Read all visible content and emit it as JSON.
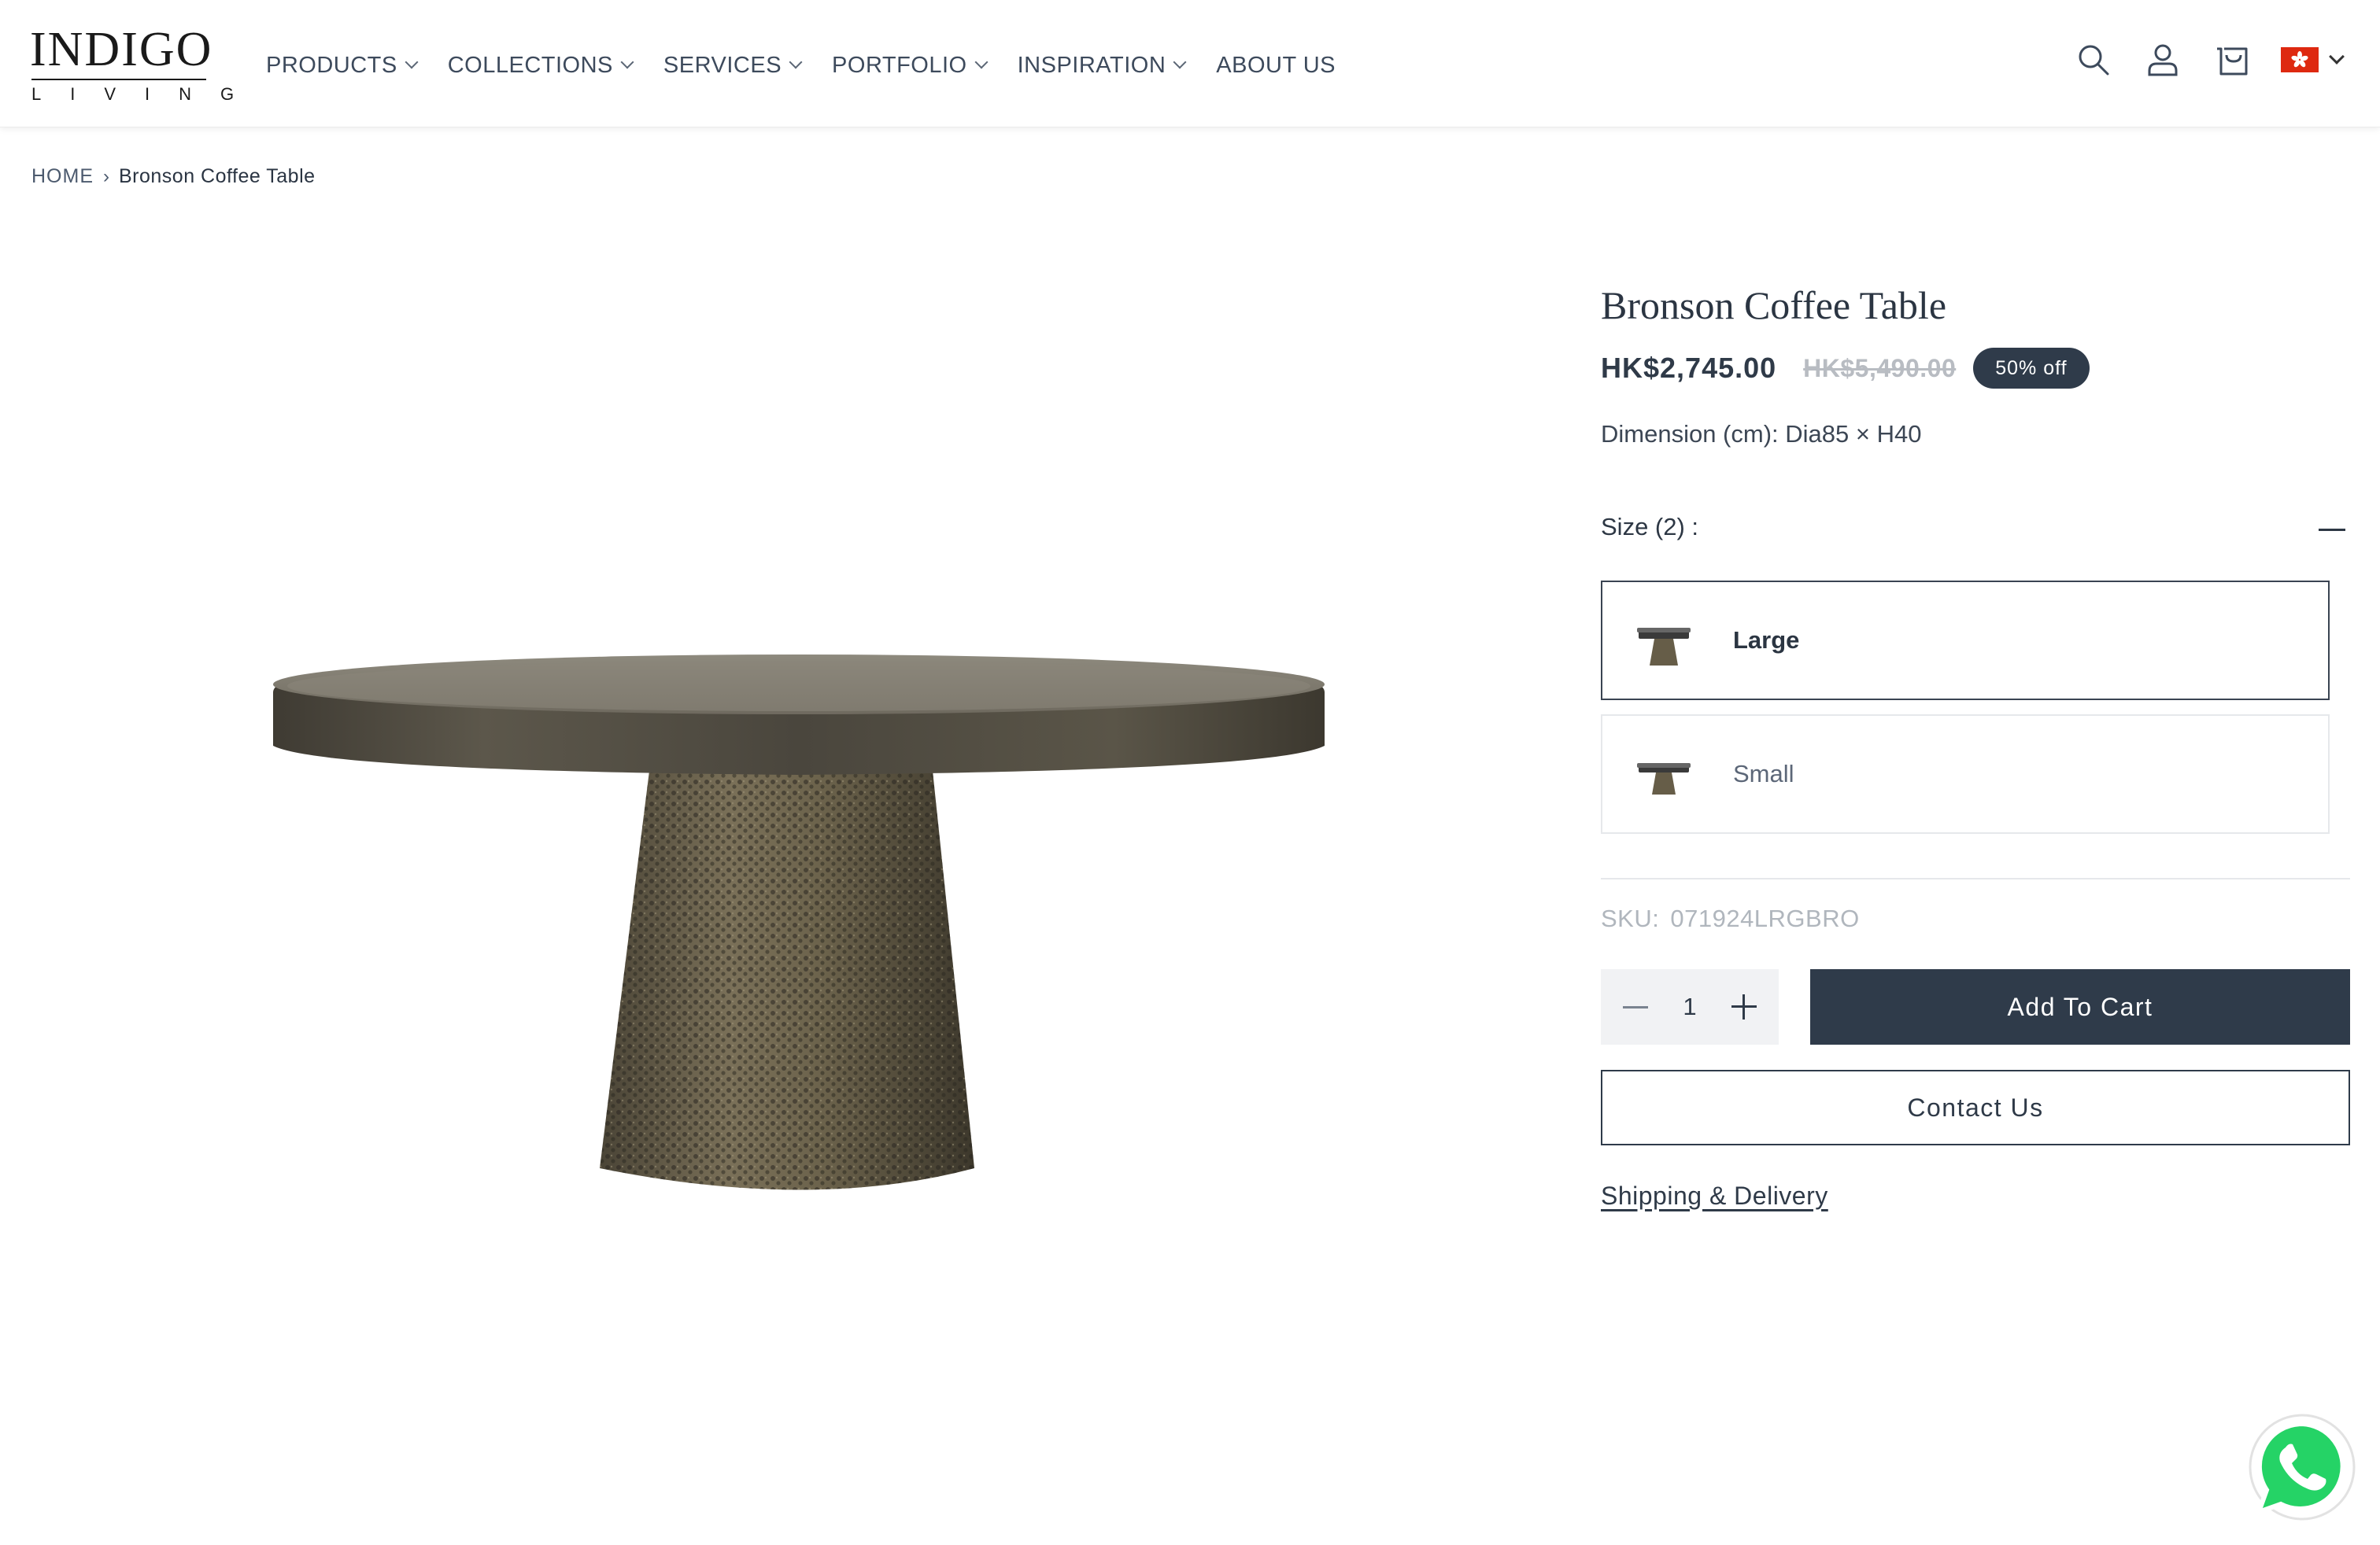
{
  "header": {
    "logo": {
      "main": "INDIGO",
      "sub": "LIVING"
    },
    "nav": [
      {
        "label": "PRODUCTS",
        "has_dropdown": true
      },
      {
        "label": "COLLECTIONS",
        "has_dropdown": true
      },
      {
        "label": "SERVICES",
        "has_dropdown": true
      },
      {
        "label": "PORTFOLIO",
        "has_dropdown": true
      },
      {
        "label": "INSPIRATION",
        "has_dropdown": true
      },
      {
        "label": "ABOUT US",
        "has_dropdown": false
      }
    ],
    "icons": [
      "search-icon",
      "account-icon",
      "cart-icon"
    ],
    "country_flag": "hong-kong-flag-icon"
  },
  "breadcrumb": {
    "home": "HOME",
    "current": "Bronson Coffee Table"
  },
  "product": {
    "title": "Bronson Coffee Table",
    "price": "HK$2,745.00",
    "compare_price": "HK$5,490.00",
    "discount_badge": "50% off",
    "dimension": "Dimension (cm): Dia85 × H40",
    "size_label": "Size (2) :",
    "variants": [
      {
        "label": "Large",
        "selected": true
      },
      {
        "label": "Small",
        "selected": false
      }
    ],
    "sku_label": "SKU:",
    "sku_value": "071924LRGBRO",
    "quantity": "1",
    "add_to_cart": "Add To Cart",
    "contact_us": "Contact Us",
    "shipping_link": "Shipping & Delivery"
  },
  "colors": {
    "primary": "#2f3b4a",
    "flag_red": "#de2910",
    "whatsapp_green": "#25d366"
  }
}
